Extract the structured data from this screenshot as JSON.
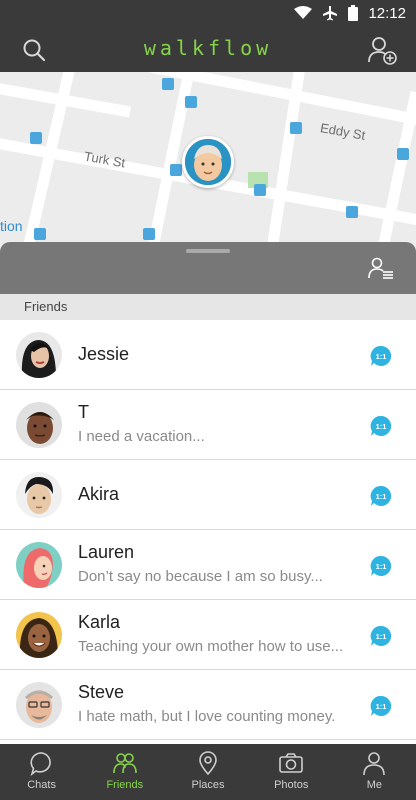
{
  "status_bar": {
    "time": "12:12",
    "icons": [
      "wifi-icon",
      "airplane-icon",
      "battery-icon"
    ]
  },
  "app_bar": {
    "title": "walkflow",
    "left_icon": "search-icon",
    "right_icon": "add-user-icon",
    "title_color": "#86d34a"
  },
  "map": {
    "streets": [
      "Turk St",
      "Eddy St"
    ],
    "poi_label": "tion"
  },
  "sheet": {
    "header_icon": "list-icon",
    "section_title": "Friends"
  },
  "friends": [
    {
      "name": "Jessie",
      "message": ""
    },
    {
      "name": "T",
      "message": "I need a vacation..."
    },
    {
      "name": "Akira",
      "message": ""
    },
    {
      "name": "Lauren",
      "message": "Don’t say no because I am so busy..."
    },
    {
      "name": "Karla",
      "message": "Teaching your own mother how to use..."
    },
    {
      "name": "Steve",
      "message": "I hate math, but I love counting money."
    }
  ],
  "chat_badge": "1:1",
  "nav": [
    {
      "label": "Chats",
      "icon": "chat-bubble-icon"
    },
    {
      "label": "Friends",
      "icon": "friends-icon"
    },
    {
      "label": "Places",
      "icon": "location-pin-icon"
    },
    {
      "label": "Photos",
      "icon": "camera-icon"
    },
    {
      "label": "Me",
      "icon": "person-icon"
    }
  ],
  "colors": {
    "accent": "#86d34a",
    "bar": "#3a3a3a",
    "chat_badge": "#2fb3e0"
  }
}
